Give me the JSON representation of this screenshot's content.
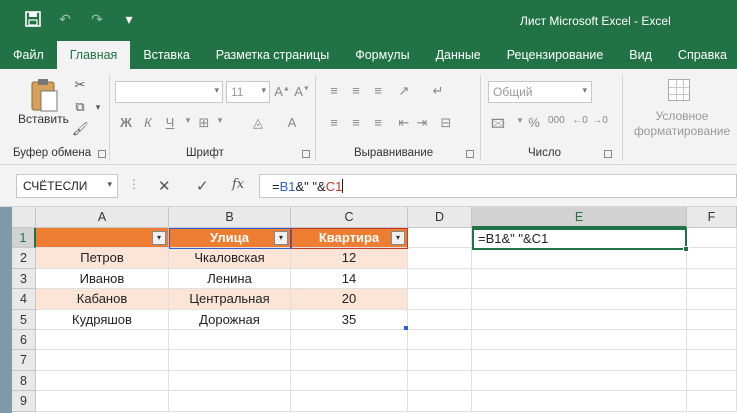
{
  "window": {
    "title": "Лист Microsoft Excel  -  Excel"
  },
  "quick_access": [
    {
      "name": "save-icon",
      "glyph": "💾"
    },
    {
      "name": "undo-icon",
      "glyph": "↶"
    },
    {
      "name": "redo-icon",
      "glyph": "↷"
    },
    {
      "name": "customize-qat-icon",
      "glyph": "▾"
    }
  ],
  "tabs": [
    {
      "label": "Файл",
      "active": false
    },
    {
      "label": "Главная",
      "active": true
    },
    {
      "label": "Вставка",
      "active": false
    },
    {
      "label": "Разметка страницы",
      "active": false
    },
    {
      "label": "Формулы",
      "active": false
    },
    {
      "label": "Данные",
      "active": false
    },
    {
      "label": "Рецензирование",
      "active": false
    },
    {
      "label": "Вид",
      "active": false
    },
    {
      "label": "Справка",
      "active": false
    }
  ],
  "ribbon": {
    "clipboard": {
      "label": "Буфер обмена",
      "paste_label": "Вставить"
    },
    "font": {
      "label": "Шрифт",
      "font_name": "",
      "font_size": "11"
    },
    "alignment": {
      "label": "Выравнивание"
    },
    "number": {
      "label": "Число",
      "format": "Общий"
    },
    "styles": {
      "conditional_label": "Условное форматирование"
    }
  },
  "formula_bar": {
    "name_box": "СЧЁТЕСЛИ",
    "formula_prefix": "=",
    "formula_ref1": "B1",
    "formula_mid": "&\" \"&",
    "formula_ref2": "C1"
  },
  "grid": {
    "columns": [
      "A",
      "B",
      "C",
      "D",
      "E",
      "F"
    ],
    "rows": [
      "1",
      "2",
      "3",
      "4",
      "5",
      "6",
      "7",
      "8",
      "9"
    ],
    "header_row": [
      "",
      "Улица",
      "Квартира"
    ],
    "data_rows": [
      [
        "Петров",
        "Чкаловская",
        "12"
      ],
      [
        "Иванов",
        "Ленина",
        "14"
      ],
      [
        "Кабанов",
        "Центральная",
        "20"
      ],
      [
        "Кудряшов",
        "Дорожная",
        "35"
      ]
    ],
    "active_cell_content": "=B1&\" \"&C1",
    "selected_column": "E",
    "selected_row": "1"
  },
  "colors": {
    "excel_green": "#217346",
    "table_header": "#ed7d31",
    "table_band": "#fce4d6",
    "ref_blue": "#2f5fd0",
    "ref_red": "#c0392b"
  }
}
